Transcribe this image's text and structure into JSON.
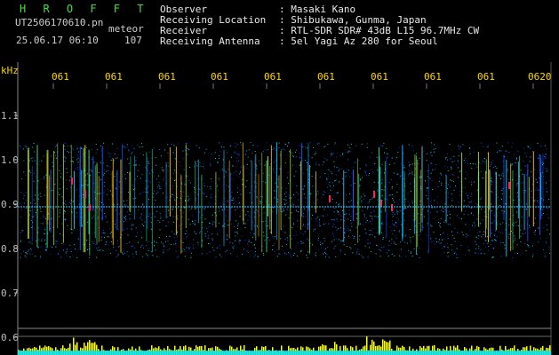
{
  "header": {
    "title": "H R O F F T",
    "filename": "UT2506170610.pn",
    "filename_suffix": "meteor",
    "datetime": "25.06.17 06:10",
    "meteor_count": "107"
  },
  "meta": [
    {
      "label": "Observer",
      "value": ": Masaki Kano"
    },
    {
      "label": "Receiving Location",
      "value": ": Shibukawa, Gunma, Japan"
    },
    {
      "label": "Receiver",
      "value": ": RTL-SDR SDR# 43dB L15 96.7MHz CW"
    },
    {
      "label": "Receiving Antenna",
      "value": ": 5el Yagi Az 280 for Seoul"
    }
  ],
  "axis": {
    "unit": "kHz",
    "y_ticks": [
      "1.1",
      "1.0",
      "0.9",
      "0.8",
      "0.7",
      "0.6"
    ],
    "x_ticks": [
      "061",
      "061",
      "061",
      "061",
      "061",
      "061",
      "061",
      "061",
      "061",
      "0620"
    ]
  },
  "colors": {
    "accent_green": "#3fe03f",
    "axis_yellow": "#ffd800",
    "carrier_line": "#46c8ff",
    "echo_red": "#ff2060",
    "activity_bars": "#ffff00",
    "baseline_cyan": "#00e5ff"
  }
}
